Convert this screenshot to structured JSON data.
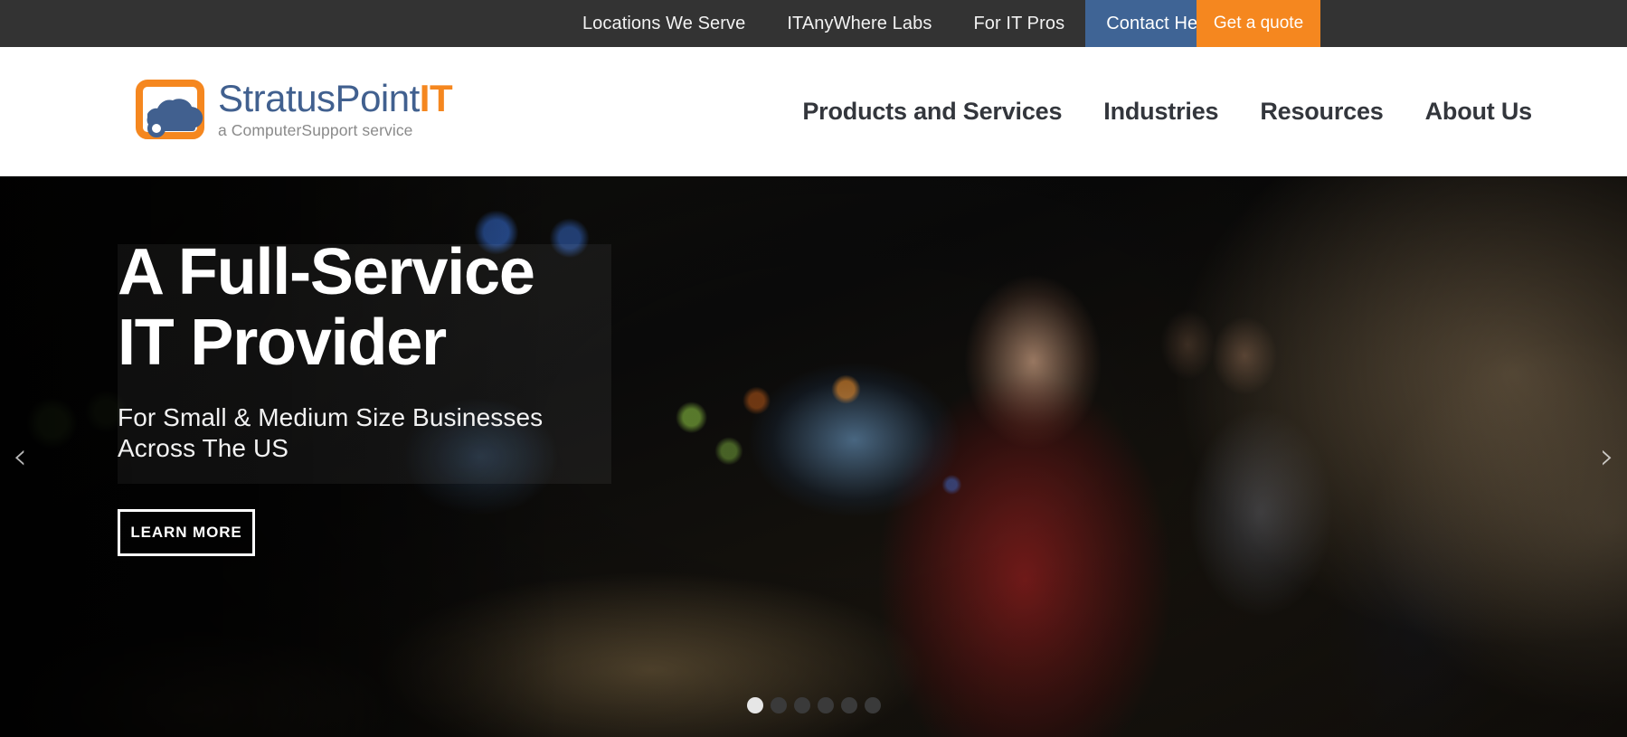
{
  "topbar": {
    "links": [
      {
        "label": "Locations We Serve",
        "active": false
      },
      {
        "label": "ITAnyWhere Labs",
        "active": false
      },
      {
        "label": "For IT Pros",
        "active": false
      },
      {
        "label": "Contact HelpDesk",
        "active": true
      }
    ],
    "quote_label": "Get a quote",
    "bg_color": "#333333",
    "active_color": "#3f6495",
    "quote_color": "#f5871f"
  },
  "header": {
    "logo": {
      "name_primary": "StratusPoint",
      "name_accent": "IT",
      "tagline": "a ComputerSupport service",
      "mark_icon": "cloud-monitor-icon",
      "primary_color": "#41608f",
      "accent_color": "#f5871f"
    },
    "nav": [
      {
        "label": "Products and Services"
      },
      {
        "label": "Industries"
      },
      {
        "label": "Resources"
      },
      {
        "label": "About Us"
      }
    ]
  },
  "hero": {
    "title_line1": "A Full-Service",
    "title_line2": "IT Provider",
    "subtitle_line1": "For Small & Medium Size Businesses",
    "subtitle_line2": "Across The US",
    "cta_label": "LEARN MORE",
    "prev_icon": "chevron-left-icon",
    "next_icon": "chevron-right-icon",
    "prev_glyph": "‹",
    "next_glyph": "›",
    "dots": [
      {
        "active": true
      },
      {
        "active": false
      },
      {
        "active": false
      },
      {
        "active": false
      },
      {
        "active": false
      },
      {
        "active": false
      }
    ]
  }
}
